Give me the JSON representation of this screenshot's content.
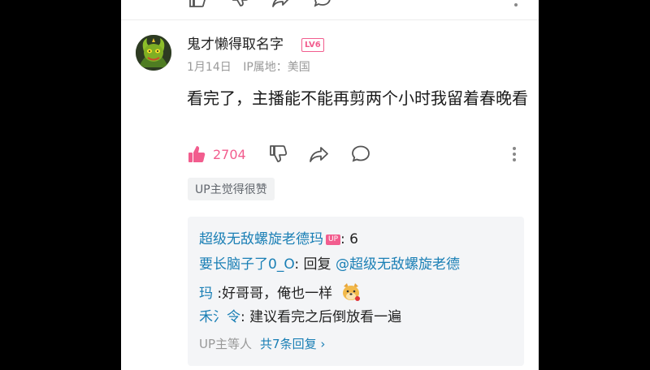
{
  "comment": {
    "username": "鬼才懒得取名字",
    "level_badge": "LV6",
    "date": "1月14日",
    "ip_location": "IP属地：美国",
    "text": "看完了，主播能不能再剪两个小时我留着春晚看",
    "like_count": "2704",
    "up_liked_label": "UP主觉得很赞"
  },
  "replies": [
    {
      "user": "超级无敌螺旋老德玛",
      "badge": "UP",
      "sep": ": ",
      "text": "6"
    },
    {
      "user": "要长脑子了0_O",
      "sep": ": ",
      "text": "回复 ",
      "mention": "@超级无敌螺旋老德"
    },
    {
      "user_cont": "玛",
      "text": " :好哥哥，俺也一样"
    },
    {
      "user": "禾氵令",
      "sep": ": ",
      "text": "建议看完之后倒放看一遍"
    }
  ],
  "replies_footer": {
    "prefix": "UP主等人",
    "link": "共7条回复",
    "chevron": "›"
  },
  "icons": {
    "like": "thumbs-up-icon",
    "dislike": "thumbs-down-icon",
    "share": "share-icon",
    "reply": "comment-icon",
    "more": "more-vertical-icon"
  },
  "colors": {
    "accent_pink": "#f25d8e",
    "link_blue": "#1a7fb5"
  }
}
